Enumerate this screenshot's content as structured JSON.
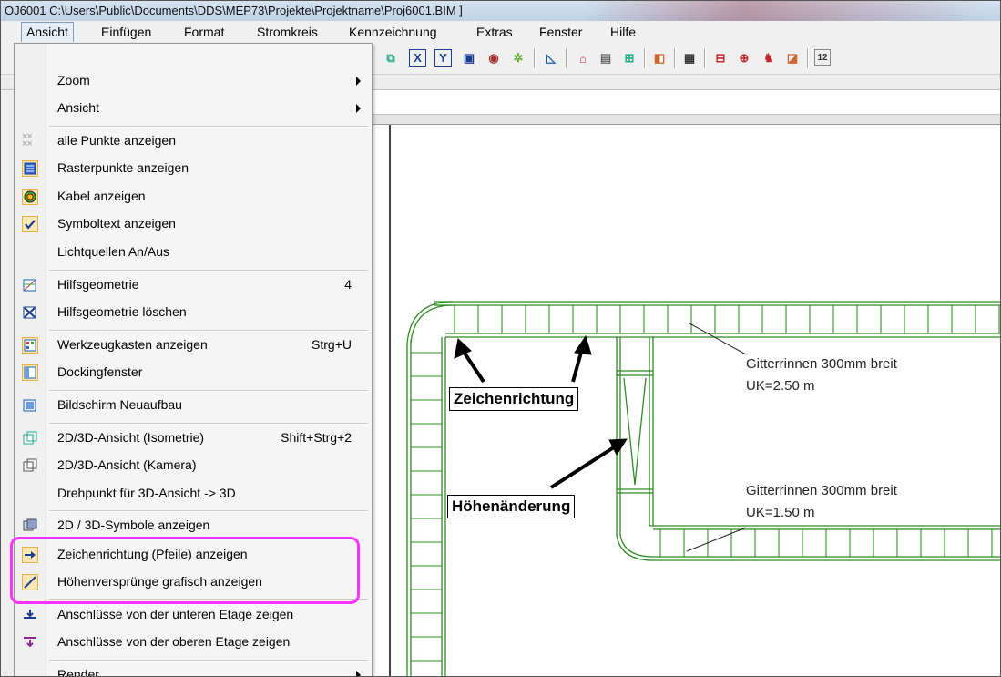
{
  "window": {
    "title": "OJ6001  C:\\Users\\Public\\Documents\\DDS\\MEP73\\Projekte\\Projektname\\Proj6001.BIM ]"
  },
  "menubar": {
    "items": [
      {
        "label": "Ansicht",
        "active": true
      },
      {
        "label": "Einfügen"
      },
      {
        "label": "Format"
      },
      {
        "label": "Stromkreis"
      },
      {
        "label": "Kennzeichnung"
      },
      {
        "label": "Extras"
      },
      {
        "label": "Fenster"
      },
      {
        "label": "Hilfe"
      }
    ]
  },
  "toolbar": {
    "icons": [
      "iso-view-icon",
      "x-axis-icon",
      "y-axis-icon",
      "window-icon",
      "eye-icon",
      "render-icon",
      "measure-icon",
      "home-icon",
      "panel-icon",
      "grid-icon",
      "color-icon",
      "document-icon",
      "layout-icon",
      "network-icon",
      "person-icon",
      "export-icon",
      "number-icon"
    ]
  },
  "view_menu": {
    "items": [
      {
        "label": "Zoom",
        "submenu": true
      },
      {
        "label": "Ansicht",
        "submenu": true
      },
      {
        "label": "alle Punkte anzeigen",
        "icon": "points-icon"
      },
      {
        "label": "Rasterpunkte anzeigen",
        "icon": "grid-points-icon",
        "checked": true
      },
      {
        "label": "Kabel anzeigen",
        "icon": "cable-icon",
        "checked": true
      },
      {
        "label": "Symboltext anzeigen",
        "icon": "checkmark-icon",
        "checked": true
      },
      {
        "label": "Lichtquellen An/Aus"
      },
      {
        "label": "Hilfsgeometrie",
        "icon": "helper-geometry-icon",
        "shortcut": "4"
      },
      {
        "label": "Hilfsgeometrie löschen",
        "icon": "delete-geometry-icon"
      },
      {
        "label": "Werkzeugkasten anzeigen",
        "icon": "toolbox-icon",
        "shortcut": "Strg+U",
        "checked": true
      },
      {
        "label": "Dockingfenster",
        "icon": "docking-icon",
        "checked": true
      },
      {
        "label": "Bildschirm Neuaufbau",
        "icon": "refresh-screen-icon"
      },
      {
        "label": "2D/3D-Ansicht (Isometrie)",
        "icon": "isometric-icon",
        "shortcut": "Shift+Strg+2"
      },
      {
        "label": "2D/3D-Ansicht (Kamera)",
        "icon": "camera-view-icon"
      },
      {
        "label": "Drehpunkt für 3D-Ansicht -> 3D"
      },
      {
        "label": "2D / 3D-Symbole anzeigen",
        "icon": "symbols-3d-icon"
      },
      {
        "label": "Zeichenrichtung (Pfeile) anzeigen",
        "icon": "arrow-right-icon",
        "checked": true
      },
      {
        "label": "Höhenversprünge grafisch anzeigen",
        "icon": "slope-icon",
        "checked": true
      },
      {
        "label": "Anschlüsse von der unteren Etage zeigen",
        "icon": "lower-floor-icon"
      },
      {
        "label": "Anschlüsse von der oberen Etage zeigen",
        "icon": "upper-floor-icon"
      },
      {
        "label": "Render",
        "submenu": true
      }
    ]
  },
  "drawing": {
    "tray1_label": "Gitterrinnen   300mm breit",
    "tray1_height": "UK=2.50 m",
    "tray2_label": "Gitterrinnen   300mm breit",
    "tray2_height": "UK=1.50 m",
    "callout_direction": "Zeichenrichtung",
    "callout_height": "Höhenänderung",
    "line_color": "#2e8b22"
  },
  "colors": {
    "highlight": "#ff33ff",
    "selection": "#e7eef7"
  }
}
